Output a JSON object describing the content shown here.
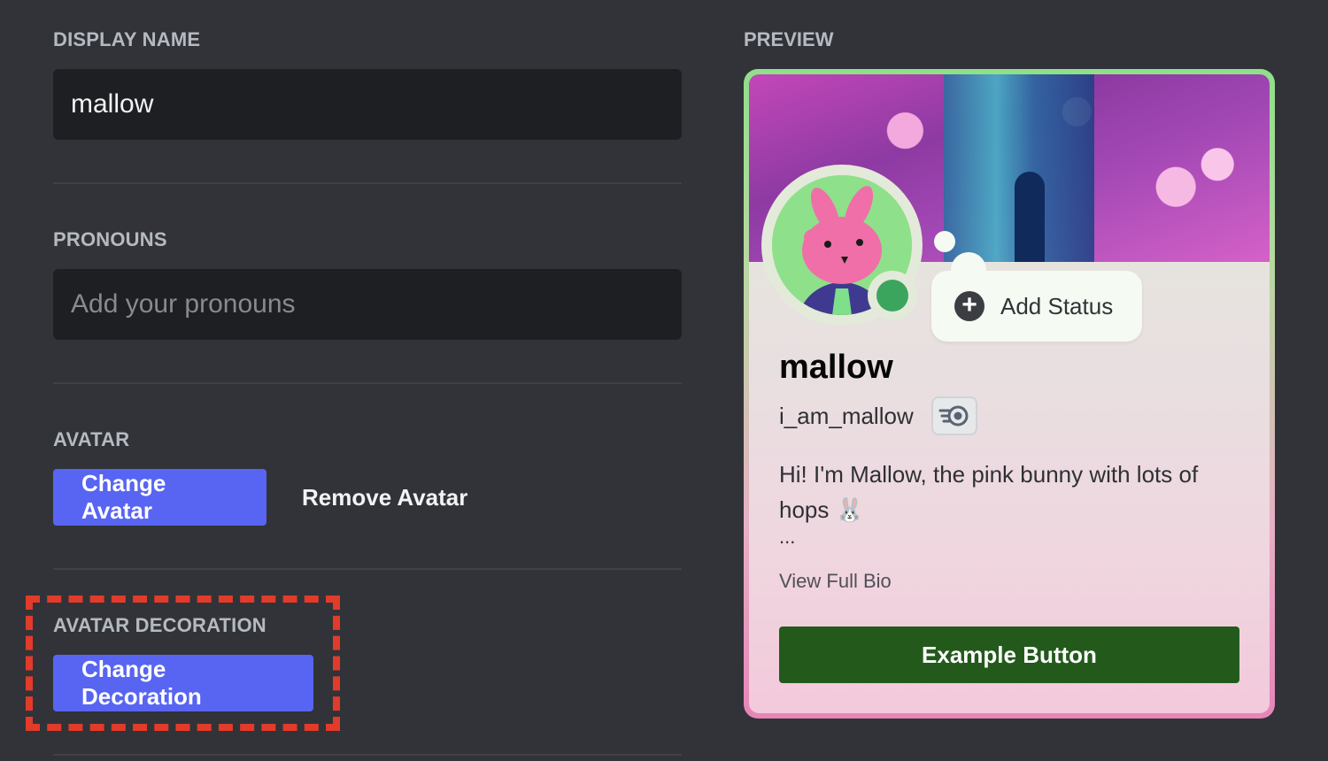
{
  "sections": {
    "display_name": {
      "label": "DISPLAY NAME",
      "value": "mallow"
    },
    "pronouns": {
      "label": "PRONOUNS",
      "placeholder": "Add your pronouns"
    },
    "avatar": {
      "label": "AVATAR",
      "change_label": "Change Avatar",
      "remove_label": "Remove Avatar"
    },
    "avatar_decoration": {
      "label": "AVATAR DECORATION",
      "change_label": "Change Decoration"
    }
  },
  "preview": {
    "label": "PREVIEW",
    "status_label": "Add Status",
    "display_name": "mallow",
    "username": "i_am_mallow",
    "bio": "Hi! I'm Mallow, the pink bunny with lots of hops 🐰",
    "bio_ellipsis": "...",
    "view_full_bio": "View Full Bio",
    "example_button": "Example Button",
    "badge_icon": "nitro-icon"
  },
  "colors": {
    "brand": "#5865f2",
    "background": "#313338",
    "input_bg": "#1e1f22",
    "highlight": "#e23b2a",
    "online": "#3ba55d",
    "example_button": "#235a1c"
  }
}
